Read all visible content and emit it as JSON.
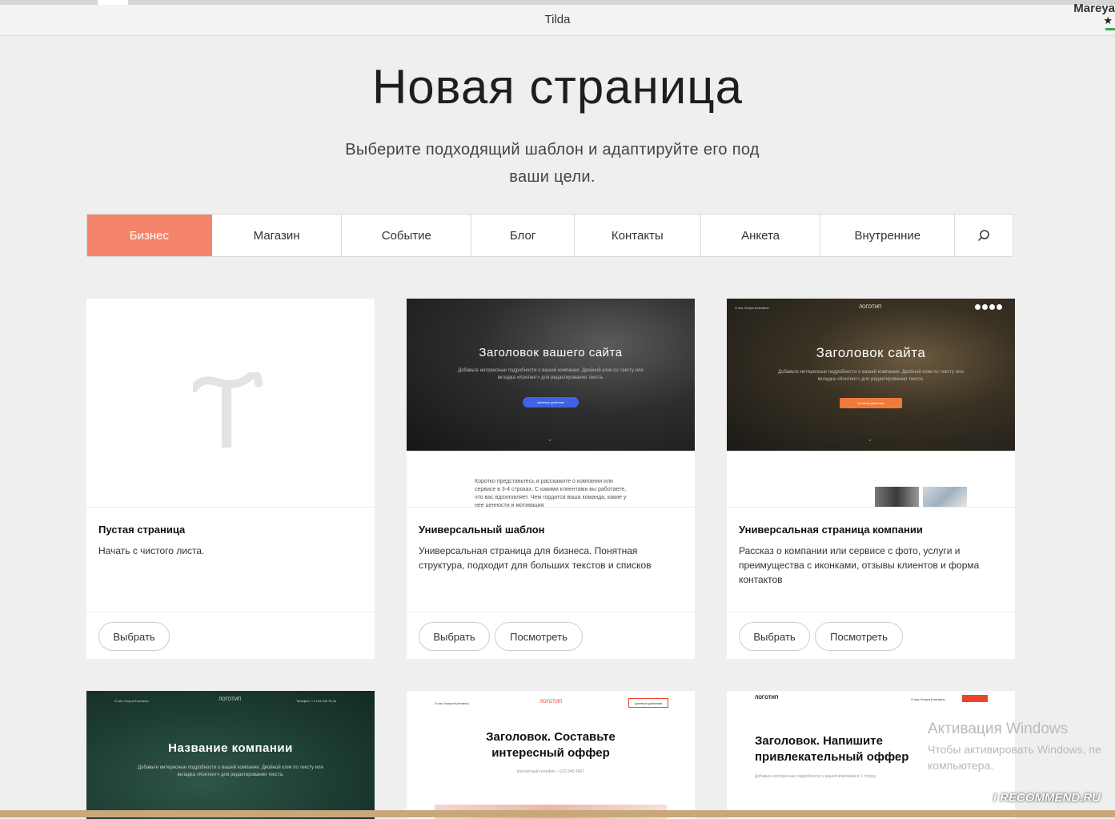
{
  "browser": {
    "title": "Tilda",
    "user": "Mareya"
  },
  "page": {
    "title": "Новая страница",
    "subtitle": "Выберите подходящий шаблон и адаптируйте его под ваши цели."
  },
  "tabs": [
    {
      "label": "Бизнес",
      "active": true
    },
    {
      "label": "Магазин"
    },
    {
      "label": "Событие"
    },
    {
      "label": "Блог"
    },
    {
      "label": "Контакты"
    },
    {
      "label": "Анкета"
    },
    {
      "label": "Внутренние"
    }
  ],
  "accent_color": "#f4856a",
  "cards": [
    {
      "name": "Пустая страница",
      "desc": "Начать с чистого листа.",
      "select": "Выбрать"
    },
    {
      "name": "Универсальный шаблон",
      "desc": "Универсальная страница для бизнеса. Понятная структура, подходит для больших текстов и списков",
      "select": "Выбрать",
      "view": "Посмотреть",
      "preview": {
        "hero_title": "Заголовок вашего сайта",
        "hero_text": "Добавьте интересные подробности о вашей компании. Двойной клик по тексту или вкладка «Контент» для редактирования текста.",
        "hero_button": "Целевое действие",
        "body_text": "Коротко представьтесь и расскажите о компании или сервисе в 3-4 строках. С какими клиентами вы работаете, что вас вдохновляет. Чем гордится ваша команда, какие у нее ценности и мотивация"
      }
    },
    {
      "name": "Универсальная страница компании",
      "desc": "Рассказ о компании или сервисе с фото, услуги и преимущества с иконками, отзывы клиентов и форма контактов",
      "select": "Выбрать",
      "view": "Посмотреть",
      "preview": {
        "nav": "О нас    Услуги    Контакты",
        "logo": "ЛОГОТИП",
        "hero_title": "Заголовок сайта",
        "hero_text": "Добавьте интересные подробности о вашей компании. Двойной клик по тексту или вкладка «Контент» для редактирования текста.",
        "hero_button": "Целевое действие"
      }
    }
  ],
  "cards_row2": [
    {
      "nav": "О нас    Услуги    Контакты",
      "logo": "ЛОГОТИП",
      "phone": "Телефон: +1 123 456 78 44",
      "title": "Название компании",
      "text": "Добавьте интересные подробности о вашей компании. Двойной клик по тексту или вкладка «Контент» для редактирования текста."
    },
    {
      "nav": "О нас    Услуги    Контакты",
      "logo": "ЛОГОТИП",
      "cta": "Целевое действие",
      "title": "Заголовок. Составьте интересный оффер",
      "sub": "контактный телефон: +123 345 4667"
    },
    {
      "logo": "ЛОГОТИП",
      "nav": "О нас    Услуги    Контакты",
      "title": "Заголовок. Напишите привлекательный оффер",
      "sub": "Добавьте интересные подробности о вашей компании в 1 строку"
    }
  ],
  "watermark": {
    "line1": "Активация Windows",
    "line2": "Чтобы активировать Windows, пе",
    "line3": "компьютера."
  },
  "badge": "I RECOMMEND.RU"
}
